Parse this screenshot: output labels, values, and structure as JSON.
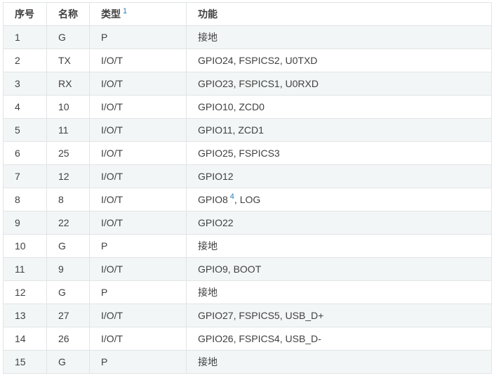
{
  "headers": [
    {
      "label": "序号",
      "note": ""
    },
    {
      "label": "名称",
      "note": ""
    },
    {
      "label": "类型",
      "note": "1"
    },
    {
      "label": "功能",
      "note": ""
    }
  ],
  "rows": [
    {
      "no": "1",
      "name": "G",
      "type": "P",
      "func": "接地",
      "note": ""
    },
    {
      "no": "2",
      "name": "TX",
      "type": "I/O/T",
      "func": "GPIO24, FSPICS2, U0TXD",
      "note": ""
    },
    {
      "no": "3",
      "name": "RX",
      "type": "I/O/T",
      "func": "GPIO23, FSPICS1, U0RXD",
      "note": ""
    },
    {
      "no": "4",
      "name": "10",
      "type": "I/O/T",
      "func": "GPIO10, ZCD0",
      "note": ""
    },
    {
      "no": "5",
      "name": "11",
      "type": "I/O/T",
      "func": "GPIO11, ZCD1",
      "note": ""
    },
    {
      "no": "6",
      "name": "25",
      "type": "I/O/T",
      "func": "GPIO25, FSPICS3",
      "note": ""
    },
    {
      "no": "7",
      "name": "12",
      "type": "I/O/T",
      "func": "GPIO12",
      "note": ""
    },
    {
      "no": "8",
      "name": "8",
      "type": "I/O/T",
      "func": "GPIO8",
      "note": "4",
      "func_tail": ", LOG"
    },
    {
      "no": "9",
      "name": "22",
      "type": "I/O/T",
      "func": "GPIO22",
      "note": ""
    },
    {
      "no": "10",
      "name": "G",
      "type": "P",
      "func": "接地",
      "note": ""
    },
    {
      "no": "11",
      "name": "9",
      "type": "I/O/T",
      "func": "GPIO9, BOOT",
      "note": ""
    },
    {
      "no": "12",
      "name": "G",
      "type": "P",
      "func": "接地",
      "note": ""
    },
    {
      "no": "13",
      "name": "27",
      "type": "I/O/T",
      "func": "GPIO27, FSPICS5, USB_D+",
      "note": ""
    },
    {
      "no": "14",
      "name": "26",
      "type": "I/O/T",
      "func": "GPIO26, FSPICS4, USB_D-",
      "note": ""
    },
    {
      "no": "15",
      "name": "G",
      "type": "P",
      "func": "接地",
      "note": ""
    }
  ]
}
